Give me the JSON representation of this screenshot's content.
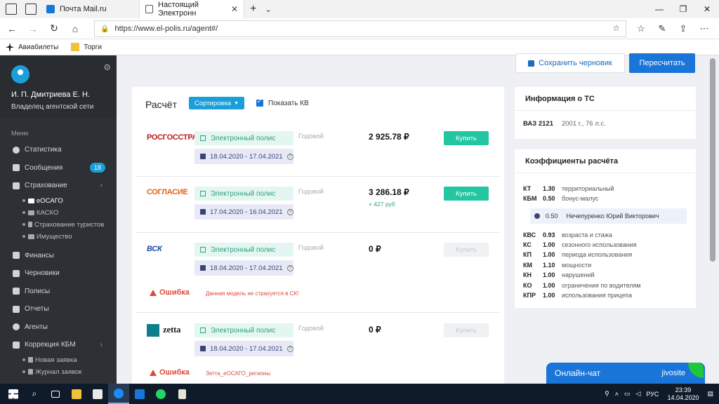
{
  "browser": {
    "tabs": [
      {
        "label": "Почта Mail.ru"
      },
      {
        "label": "Настоящий Электронн"
      }
    ],
    "url": "https://www.el-polis.ru/agent#/",
    "favorites": [
      {
        "label": "Авиабилеты"
      },
      {
        "label": "Торги"
      }
    ]
  },
  "sidebar": {
    "user_name": "И. П. Дмитриева Е. Н.",
    "user_role": "Владелец агентской сети",
    "menu_title": "Меню",
    "items": [
      {
        "label": "Статистика"
      },
      {
        "label": "Сообщения",
        "badge": "18"
      },
      {
        "label": "Страхование"
      }
    ],
    "sub_insurance": [
      {
        "label": "еОСАГО"
      },
      {
        "label": "КАСКО"
      },
      {
        "label": "Страхование туристов"
      },
      {
        "label": "Имущество"
      }
    ],
    "items2": [
      {
        "label": "Финансы"
      },
      {
        "label": "Черновики"
      },
      {
        "label": "Полисы"
      },
      {
        "label": "Отчеты"
      },
      {
        "label": "Агенты"
      },
      {
        "label": "Коррекция КБМ"
      }
    ],
    "sub_kbm": [
      {
        "label": "Новая заявка"
      },
      {
        "label": "Журнал заявок"
      }
    ]
  },
  "actions": {
    "save_draft": "Сохранить черновик",
    "recalc": "Пересчитать"
  },
  "calc": {
    "title": "Расчёт",
    "sort_label": "Сортировка",
    "show_kv": "Показать КВ",
    "rows": [
      {
        "insurer": "РОСГОССТРАХ",
        "policy": "Электронный полис",
        "dates": "18.04.2020 - 17.04.2021",
        "period": "Годовой",
        "price": "2 925.78 ₽",
        "diff": "",
        "buy": "Купить",
        "error": "",
        "error_msg": ""
      },
      {
        "insurer": "СОГЛАСИЕ",
        "policy": "Электронный полис",
        "dates": "17.04.2020 - 16.04.2021",
        "period": "Годовой",
        "price": "3 286.18 ₽",
        "diff": "+ 427 руб",
        "buy": "Купить",
        "error": "",
        "error_msg": ""
      },
      {
        "insurer": "ВСК",
        "policy": "Электронный полис",
        "dates": "18.04.2020 - 17.04.2021",
        "period": "Годовой",
        "price": "0 ₽",
        "diff": "",
        "buy": "Купить",
        "error": "Ошибка",
        "error_msg": "Данная модель не страхуется в СК!"
      },
      {
        "insurer": "zetta",
        "policy": "Электронный полис",
        "dates": "18.04.2020 - 17.04.2021",
        "period": "Годовой",
        "price": "0 ₽",
        "diff": "",
        "buy": "Купить",
        "error": "Ошибка",
        "error_msg": "Зетта_еОСАГО_регионы"
      }
    ]
  },
  "vehicle": {
    "title": "Информация о ТС",
    "model": "ВАЗ 2121",
    "details": "2001 г., 76 л.с."
  },
  "coeffs": {
    "title": "Коэффициенты расчёта",
    "top": [
      {
        "k": "КТ",
        "v": "1.30",
        "t": "территориальный"
      },
      {
        "k": "КБМ",
        "v": "0.50",
        "t": "бонус-малус"
      }
    ],
    "kbm_driver": {
      "v": "0.50",
      "name": "Нечепуренко Юрий Викторович"
    },
    "rest": [
      {
        "k": "КВС",
        "v": "0.93",
        "t": "возраста и стажа"
      },
      {
        "k": "КС",
        "v": "1.00",
        "t": "сезонного использования"
      },
      {
        "k": "КП",
        "v": "1.00",
        "t": "периода использования"
      },
      {
        "k": "КМ",
        "v": "1.10",
        "t": "мощности"
      },
      {
        "k": "КН",
        "v": "1.00",
        "t": "нарушений"
      },
      {
        "k": "КО",
        "v": "1.00",
        "t": "ограничения по водителям"
      },
      {
        "k": "КПР",
        "v": "1.00",
        "t": "использования прицепа"
      }
    ]
  },
  "chat": {
    "label": "Онлайн-чат",
    "brand": "jivosite"
  },
  "taskbar": {
    "lang": "РУС",
    "time": "23:39",
    "date": "14.04.2020"
  }
}
